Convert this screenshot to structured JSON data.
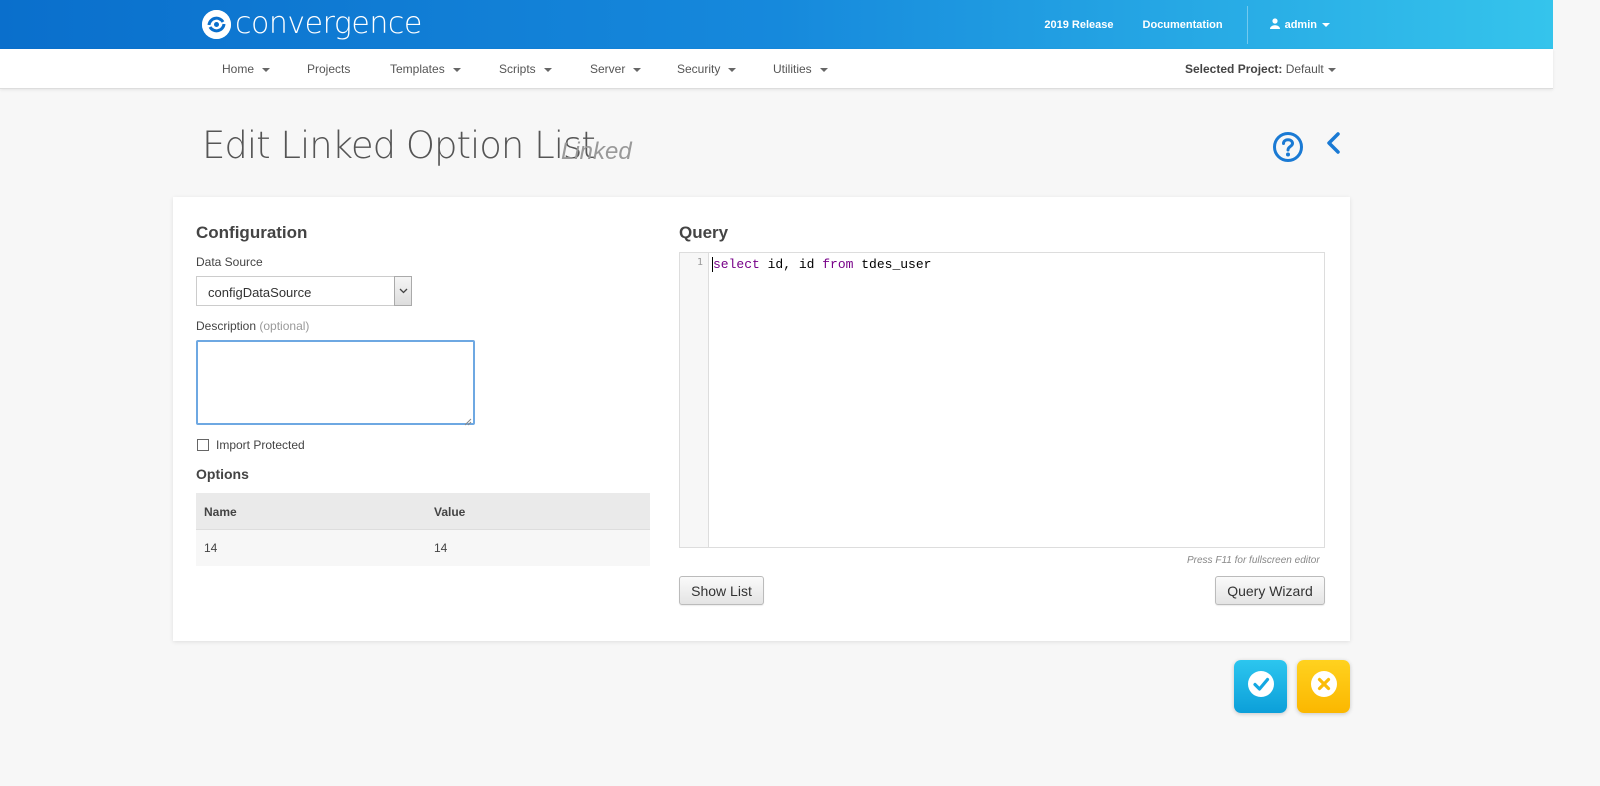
{
  "brand": {
    "name": "convergence"
  },
  "header": {
    "release_label": "2019 Release",
    "documentation_label": "Documentation",
    "user_label": "admin"
  },
  "nav": {
    "items": [
      {
        "label": "Home",
        "has_menu": true
      },
      {
        "label": "Projects",
        "has_menu": false
      },
      {
        "label": "Templates",
        "has_menu": true
      },
      {
        "label": "Scripts",
        "has_menu": true
      },
      {
        "label": "Server",
        "has_menu": true
      },
      {
        "label": "Security",
        "has_menu": true
      },
      {
        "label": "Utilities",
        "has_menu": true
      }
    ],
    "project_prefix": "Selected Project:",
    "project_value": "Default"
  },
  "page": {
    "title": "Edit Linked Option List",
    "subtitle": "Linked"
  },
  "configuration": {
    "heading": "Configuration",
    "data_source_label": "Data Source",
    "data_source_value": "configDataSource",
    "description_label": "Description",
    "description_optional": "(optional)",
    "description_value": "",
    "import_protected_label": "Import Protected",
    "import_protected_checked": false
  },
  "options": {
    "heading": "Options",
    "columns": [
      "Name",
      "Value"
    ],
    "rows": [
      {
        "name": "14",
        "value": "14"
      }
    ]
  },
  "query": {
    "heading": "Query",
    "line_number": "1",
    "code": {
      "kw_select": "select",
      "part1": " id, id ",
      "kw_from": "from",
      "part2": " tdes_user"
    },
    "hint": "Press F11 for fullscreen editor",
    "show_list_label": "Show List",
    "wizard_label": "Query Wizard"
  },
  "colors": {
    "header_gradient_start": "#0a6fcc",
    "header_gradient_end": "#35c4ec",
    "accent_blue": "#1a7ad4",
    "save_button": "#15b2e6",
    "cancel_button": "#fdc30e",
    "keyword": "#770088"
  },
  "icons": {
    "help": "question-circle-icon",
    "back": "chevron-left-icon",
    "save": "check-circle-icon",
    "cancel": "x-circle-icon",
    "user": "user-icon"
  }
}
